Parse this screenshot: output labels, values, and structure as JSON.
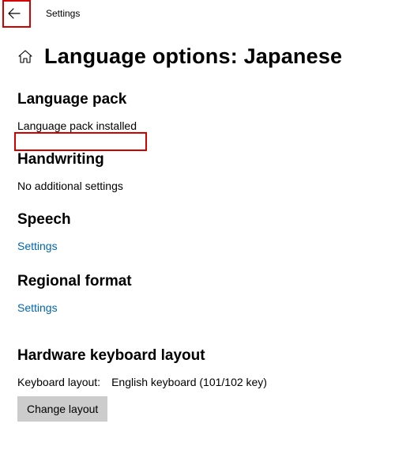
{
  "titlebar": {
    "app_title": "Settings"
  },
  "header": {
    "page_title": "Language options: Japanese"
  },
  "sections": {
    "language_pack": {
      "heading": "Language pack",
      "status": "Language pack installed"
    },
    "handwriting": {
      "heading": "Handwriting",
      "status": "No additional settings"
    },
    "speech": {
      "heading": "Speech",
      "link": "Settings"
    },
    "regional_format": {
      "heading": "Regional format",
      "link": "Settings"
    },
    "hardware_keyboard": {
      "heading": "Hardware keyboard layout",
      "label": "Keyboard layout:",
      "value": "English keyboard (101/102 key)",
      "button": "Change layout"
    }
  }
}
